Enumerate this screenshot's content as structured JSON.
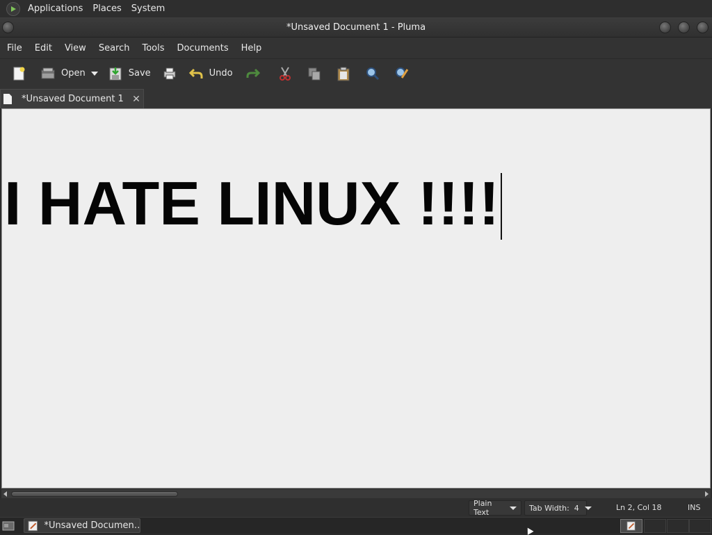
{
  "top_panel": {
    "menus": [
      "Applications",
      "Places",
      "System"
    ],
    "logo_icon": "mate-logo-icon"
  },
  "window": {
    "title": "*Unsaved Document 1 - Pluma",
    "controls": [
      "minimize",
      "maximize",
      "close"
    ]
  },
  "menubar": {
    "items": [
      "File",
      "Edit",
      "View",
      "Search",
      "Tools",
      "Documents",
      "Help"
    ]
  },
  "toolbar": {
    "new_icon": "new-document-icon",
    "open_label": "Open",
    "save_label": "Save",
    "print_icon": "print-icon",
    "undo_label": "Undo",
    "redo_icon": "redo-icon",
    "cut_icon": "cut-icon",
    "copy_icon": "copy-icon",
    "paste_icon": "paste-icon",
    "find_icon": "find-icon",
    "replace_icon": "find-replace-icon"
  },
  "tabs": [
    {
      "label": "*Unsaved Document 1"
    }
  ],
  "editor": {
    "lines": [
      "",
      "I HATE LINUX !!!!"
    ]
  },
  "statusbar": {
    "language": "Plain Text",
    "tab_width": "Tab Width:  4",
    "position": "Ln 2, Col 18",
    "mode": "INS"
  },
  "taskbar": {
    "window_label": "*Unsaved Documen…"
  },
  "colors": {
    "panel_bg": "#2e2e2e",
    "editor_bg": "#eeeeee",
    "text_dark": "#050505"
  }
}
